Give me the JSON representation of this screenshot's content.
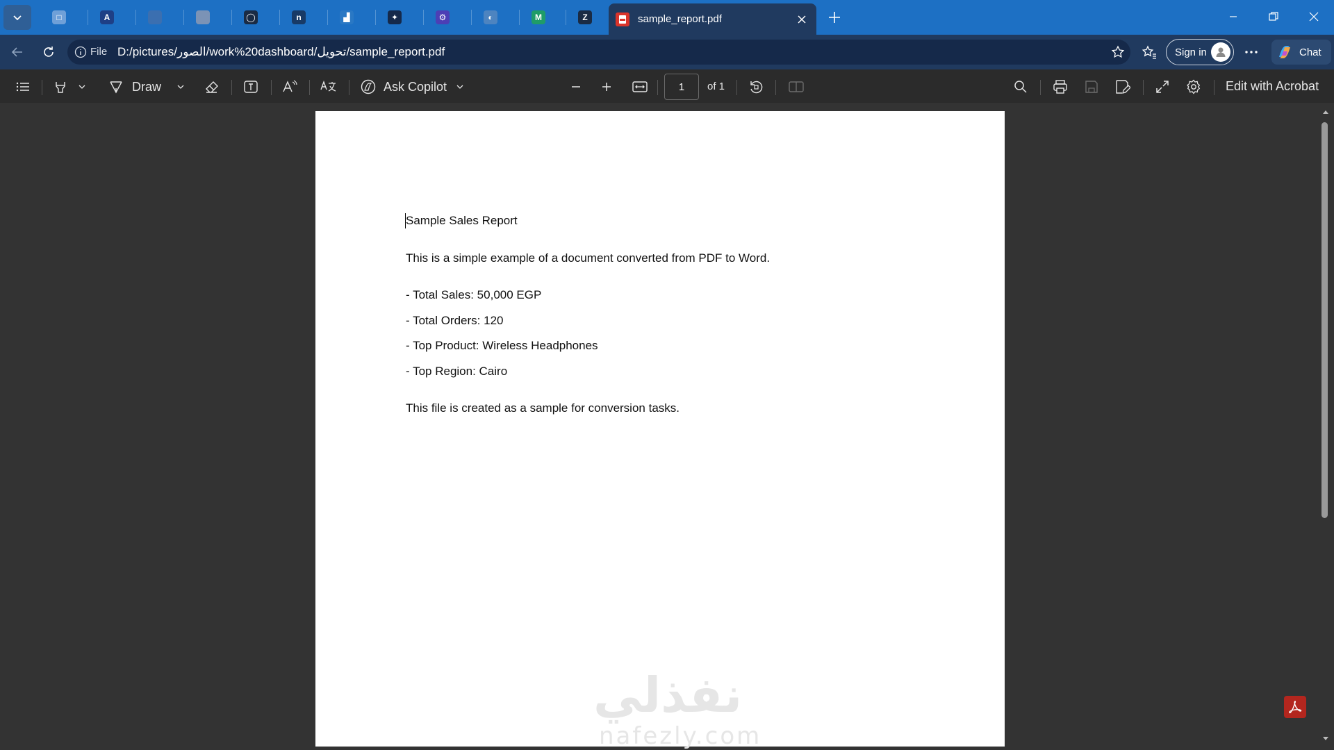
{
  "browser": {
    "active_tab": {
      "title": "sample_report.pdf",
      "icon": "pdf-file-icon"
    },
    "pinned_tabs": [
      {
        "name": "tab-1",
        "glyph": "□",
        "color": "#6fa0d8"
      },
      {
        "name": "tab-2",
        "glyph": "A",
        "color": "#1e3f86"
      },
      {
        "name": "tab-3",
        "glyph": "",
        "color": "#3b6fb0"
      },
      {
        "name": "tab-4",
        "glyph": "",
        "color": "#7b93b6"
      },
      {
        "name": "tab-5",
        "glyph": "◯",
        "color": "#1a2b44"
      },
      {
        "name": "tab-6",
        "glyph": "n",
        "color": "#183a66"
      },
      {
        "name": "tab-7",
        "glyph": "▟",
        "color": "#2a78c4"
      },
      {
        "name": "tab-8",
        "glyph": "✦",
        "color": "#15294a"
      },
      {
        "name": "tab-9",
        "glyph": "⚙",
        "color": "#4c3fb5"
      },
      {
        "name": "tab-10",
        "glyph": "◐",
        "color": "#4d84c0"
      },
      {
        "name": "tab-11",
        "glyph": "M",
        "color": "#1f9c68"
      },
      {
        "name": "tab-12",
        "glyph": "Z",
        "color": "#1a2b44"
      }
    ],
    "address": {
      "scheme_label": "File",
      "url": "D:/pictures/الصور/work%20dashboard/تحويل/sample_report.pdf"
    },
    "sign_in_label": "Sign in",
    "chat_label": "Chat"
  },
  "pdf_toolbar": {
    "draw_label": "Draw",
    "ask_copilot_label": "Ask Copilot",
    "page_current": "1",
    "page_total_label": "of 1",
    "edit_acrobat_label": "Edit with Acrobat"
  },
  "document": {
    "title": "Sample Sales Report",
    "intro": "This is a simple example of a document converted from PDF to Word.",
    "bullets": [
      "- Total Sales: 50,000 EGP",
      "- Total Orders: 120",
      "- Top Product: Wireless Headphones",
      "- Top Region: Cairo"
    ],
    "closing": "This file is created as a sample for conversion tasks."
  },
  "watermark": {
    "arabic": "نفذلي",
    "latin": "nafezly.com"
  },
  "colors": {
    "tabstrip": "#1d70c4",
    "navbar": "#203a5f",
    "toolbar": "#2b2b2b",
    "viewer_bg": "#333333",
    "acrobat_red": "#b3261e"
  }
}
